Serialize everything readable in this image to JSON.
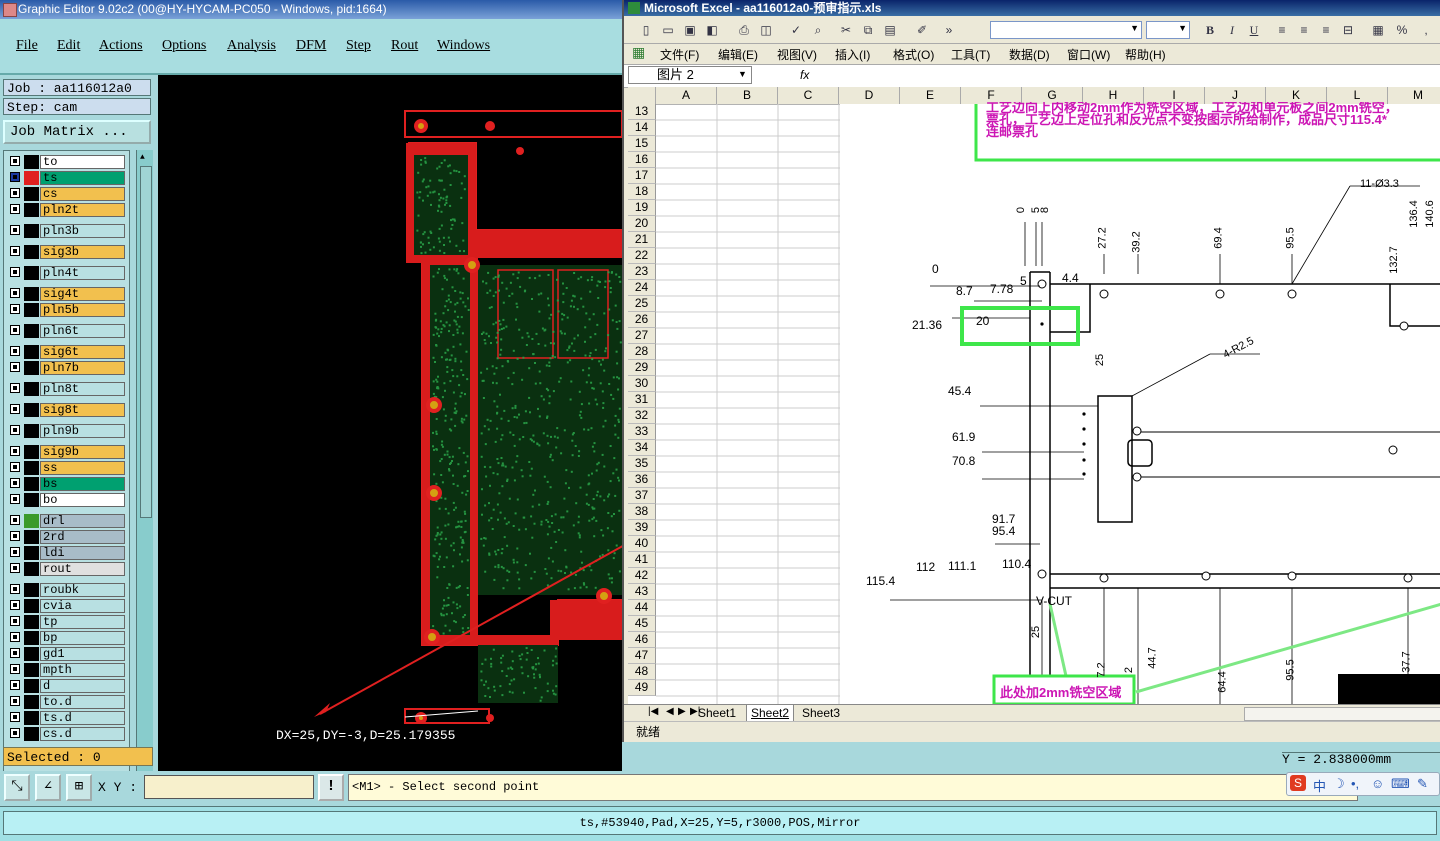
{
  "cam": {
    "title": "Graphic Editor 9.02c2 (00@HY-HYCAM-PC050 - Windows, pid:1664)",
    "menu": [
      "File",
      "Edit",
      "Actions",
      "Options",
      "Analysis",
      "DFM",
      "Step",
      "Rout",
      "Windows"
    ],
    "job": "Job : aa116012a0",
    "step": "Step: cam",
    "job_matrix": "Job Matrix ...",
    "selected": "Selected : 0",
    "xy_label": "X Y :",
    "prompt": "<M1> - Select second point",
    "measure": "DX=25,DY=-3,D=25.179355",
    "status": "ts,#53940,Pad,X=25,Y=5,r3000,POS,Mirror",
    "coord_y": "Y = 2.838000mm",
    "layers": [
      {
        "name": "to",
        "color": "#ffffff",
        "swatch": "#000000"
      },
      {
        "name": "ts",
        "color": "#00a070",
        "swatch": "#e02020"
      },
      {
        "name": "cs",
        "color": "#f2c04e",
        "swatch": "#000000"
      },
      {
        "name": "pln2t",
        "color": "#f2c04e",
        "swatch": "#000000"
      },
      {
        "name": "pln3b",
        "color": "#b8e0e2",
        "swatch": "#000000"
      },
      {
        "name": "sig3b",
        "color": "#f2c04e",
        "swatch": "#000000"
      },
      {
        "name": "pln4t",
        "color": "#b8e0e2",
        "swatch": "#000000"
      },
      {
        "name": "sig4t",
        "color": "#f2c04e",
        "swatch": "#000000"
      },
      {
        "name": "pln5b",
        "color": "#f2c04e",
        "swatch": "#000000"
      },
      {
        "name": "pln6t",
        "color": "#b8e0e2",
        "swatch": "#000000"
      },
      {
        "name": "sig6t",
        "color": "#f2c04e",
        "swatch": "#000000"
      },
      {
        "name": "pln7b",
        "color": "#f2c04e",
        "swatch": "#000000"
      },
      {
        "name": "pln8t",
        "color": "#b8e0e2",
        "swatch": "#000000"
      },
      {
        "name": "sig8t",
        "color": "#f2c04e",
        "swatch": "#000000"
      },
      {
        "name": "pln9b",
        "color": "#b8e0e2",
        "swatch": "#000000"
      },
      {
        "name": "sig9b",
        "color": "#f2c04e",
        "swatch": "#000000"
      },
      {
        "name": "ss",
        "color": "#f2c04e",
        "swatch": "#000000"
      },
      {
        "name": "bs",
        "color": "#00a070",
        "swatch": "#000000"
      },
      {
        "name": "bo",
        "color": "#ffffff",
        "swatch": "#000000"
      },
      {
        "name": "drl",
        "color": "#a8bcc8",
        "swatch": "#3a9a2a"
      },
      {
        "name": "2rd",
        "color": "#a8bcc8",
        "swatch": "#000000"
      },
      {
        "name": "ldi",
        "color": "#a8bcc8",
        "swatch": "#000000"
      },
      {
        "name": "rout",
        "color": "#e0e0e0",
        "swatch": "#000000"
      },
      {
        "name": "roubk",
        "color": "#b8e0e2",
        "swatch": "#000000"
      },
      {
        "name": "cvia",
        "color": "#b8e0e2",
        "swatch": "#000000"
      },
      {
        "name": "tp",
        "color": "#b8e0e2",
        "swatch": "#000000"
      },
      {
        "name": "bp",
        "color": "#b8e0e2",
        "swatch": "#000000"
      },
      {
        "name": "gd1",
        "color": "#b8e0e2",
        "swatch": "#000000"
      },
      {
        "name": "mpth",
        "color": "#b8e0e2",
        "swatch": "#000000"
      },
      {
        "name": "d",
        "color": "#b8e0e2",
        "swatch": "#000000"
      },
      {
        "name": "to.d",
        "color": "#b8e0e2",
        "swatch": "#000000"
      },
      {
        "name": "ts.d",
        "color": "#b8e0e2",
        "swatch": "#000000"
      },
      {
        "name": "cs.d",
        "color": "#b8e0e2",
        "swatch": "#000000"
      }
    ]
  },
  "excel": {
    "title": "Microsoft Excel - aa116012a0-预审指示.xls",
    "menu": [
      "文件(F)",
      "编辑(E)",
      "视图(V)",
      "插入(I)",
      "格式(O)",
      "工具(T)",
      "数据(D)",
      "窗口(W)",
      "帮助(H)"
    ],
    "name_box": "图片 2",
    "fx": "fx",
    "columns": [
      "A",
      "B",
      "C",
      "D",
      "E",
      "F",
      "G",
      "H",
      "I",
      "J",
      "K",
      "L",
      "M"
    ],
    "rows": [
      "13",
      "14",
      "15",
      "16",
      "17",
      "18",
      "19",
      "20",
      "21",
      "22",
      "23",
      "24",
      "25",
      "26",
      "27",
      "28",
      "29",
      "30",
      "31",
      "32",
      "33",
      "34",
      "35",
      "36",
      "37",
      "38",
      "39",
      "40",
      "41",
      "42",
      "43",
      "44",
      "45",
      "46",
      "47",
      "48",
      "49"
    ],
    "sheets": [
      "Sheet1",
      "Sheet2",
      "Sheet3"
    ],
    "status": "就绪",
    "note_line1": "工艺边向上内移动2mm作为铣空区域，工艺边和单元板之间2mm铣空，",
    "note_line2": "票孔，工艺边上定位孔和反光点不变按图示所给制作，成品尺寸115.4*",
    "note_line3": "连邮票孔",
    "callout": "此处加2mm铣空区域",
    "vcut": "V-CUT",
    "dims_left": [
      "0",
      "8.7",
      "7.78",
      "5",
      "21.36",
      "20",
      "45.4",
      "61.9",
      "70.8",
      "91.7",
      "95.4",
      "112",
      "111.1",
      "110.4",
      "115.4",
      "4.4"
    ],
    "dims_top": [
      "0",
      "5",
      "8",
      "27.2",
      "39.2",
      "69.4",
      "95.5",
      "132.7",
      "136.4",
      "140.6",
      "11-Ø3.3",
      "4-R2.5",
      "25"
    ],
    "dims_bottom": [
      "25",
      "7.2",
      "2",
      "44.7",
      "64.4",
      "95.5",
      "37.7"
    ]
  }
}
